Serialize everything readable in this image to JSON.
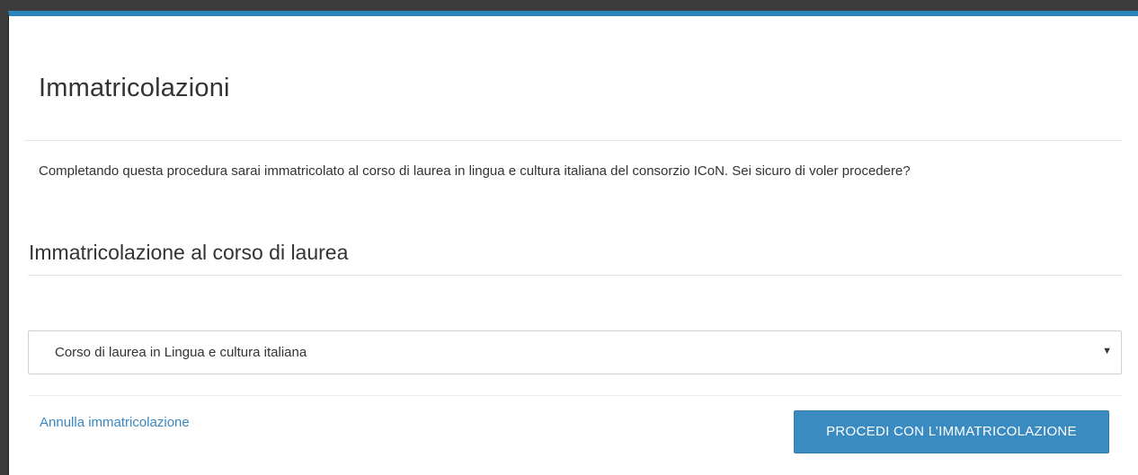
{
  "modal": {
    "title": "Immatricolazioni",
    "intro": "Completando questa procedura sarai immatricolato al corso di laurea in lingua e cultura italiana del consorzio ICoN. Sei sicuro di voler procedere?",
    "section_title": "Immatricolazione al corso di laurea",
    "course_select": {
      "selected": "Corso di laurea in Lingua e cultura italiana",
      "caret_icon": "▼"
    },
    "cancel_link": "Annulla immatricolazione",
    "proceed_button": "PROCEDI CON L’IMMATRICOLAZIONE"
  },
  "colors": {
    "accent": "#2b83b9",
    "button": "#3a8bc2",
    "link": "#3a87c0"
  }
}
